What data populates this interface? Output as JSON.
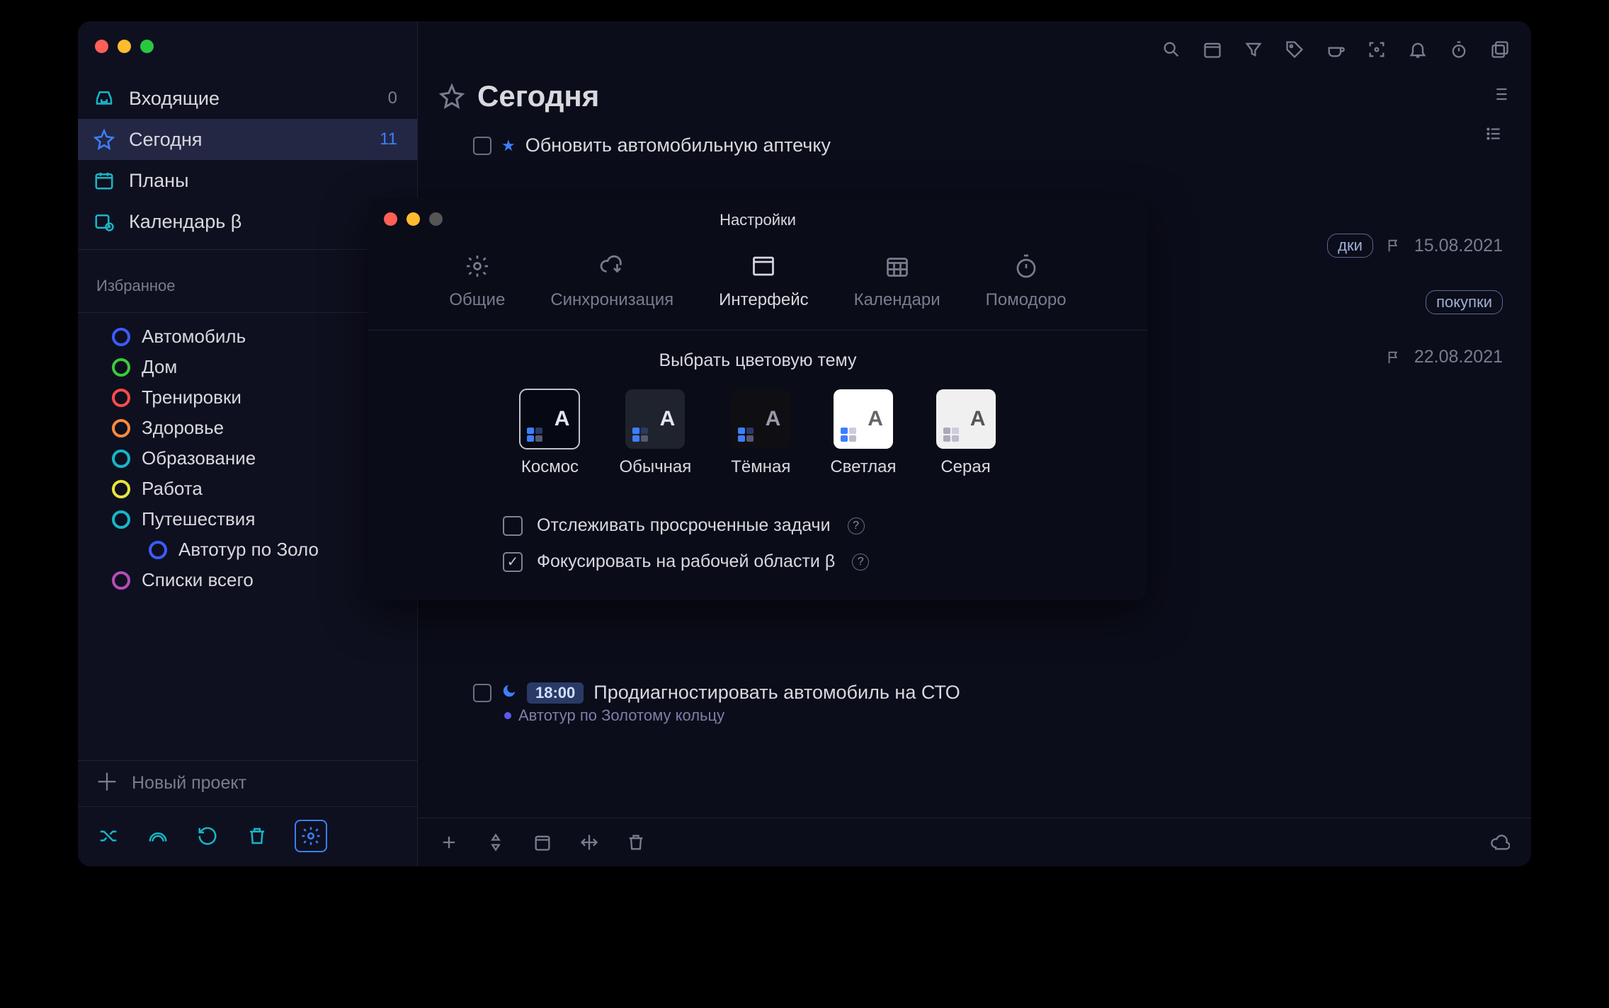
{
  "window": {
    "title": "Сегодня"
  },
  "sidebar": {
    "nav": [
      {
        "label": "Входящие",
        "count": "0"
      },
      {
        "label": "Сегодня",
        "count": "11"
      },
      {
        "label": "Планы",
        "count": ""
      },
      {
        "label": "Календарь β",
        "count": ""
      }
    ],
    "favorites_label": "Избранное",
    "projects": [
      {
        "label": "Автомобиль",
        "color": "#3d5bff"
      },
      {
        "label": "Дом",
        "color": "#3acb3a"
      },
      {
        "label": "Тренировки",
        "color": "#ff4b4b"
      },
      {
        "label": "Здоровье",
        "color": "#ff8a3d"
      },
      {
        "label": "Образование",
        "color": "#17b6c7"
      },
      {
        "label": "Работа",
        "color": "#e6e63d"
      },
      {
        "label": "Путешествия",
        "color": "#17b6c7"
      },
      {
        "label": "Автотур по Золо",
        "color": "#3d5bff",
        "sub": true
      },
      {
        "label": "Списки всего",
        "color": "#b84bb8"
      }
    ],
    "new_project": "Новый проект"
  },
  "tasks": {
    "t1": {
      "title": "Обновить автомобильную аптечку",
      "starred": true
    },
    "t2": {
      "title": "Продиагностировать автомобиль на СТО",
      "time": "18:00",
      "sub": "Автотур по Золотому кольцу"
    },
    "meta": {
      "flag1": "15.08.2021",
      "flag2": "22.08.2021",
      "tag1": "дки",
      "tag2": "покупки"
    }
  },
  "settings": {
    "title": "Настройки",
    "tabs": {
      "general": "Общие",
      "sync": "Синхронизация",
      "interface": "Интерфейс",
      "calendars": "Календари",
      "pomodoro": "Помодоро"
    },
    "theme_label": "Выбрать цветовую тему",
    "themes": {
      "cosmos": "Космос",
      "normal": "Обычная",
      "dark": "Тёмная",
      "light": "Светлая",
      "grey": "Серая"
    },
    "opt1": "Отслеживать просроченные задачи",
    "opt2": "Фокусировать на рабочей области β"
  }
}
